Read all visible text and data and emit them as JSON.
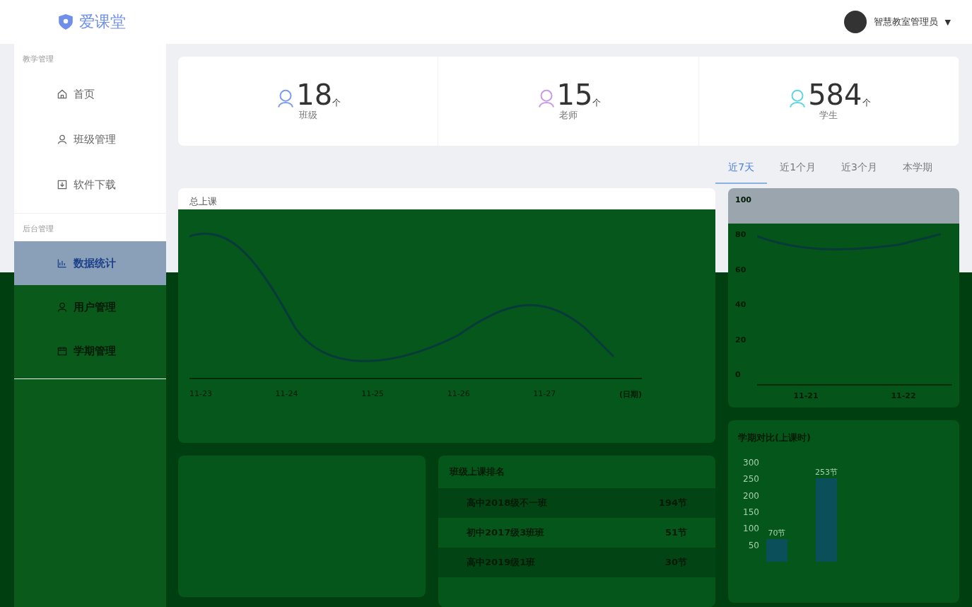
{
  "header": {
    "logo": "爱课堂",
    "user": "智慧教室管理员",
    "caret": "▼"
  },
  "sidebar": {
    "groups": [
      {
        "title": "教学管理",
        "items": [
          {
            "label": "首页",
            "selected": false
          },
          {
            "label": "班级管理",
            "selected": false
          },
          {
            "label": "软件下载",
            "selected": false
          }
        ]
      },
      {
        "title": "后台管理",
        "items": [
          {
            "label": "数据统计",
            "selected": true
          },
          {
            "label": "用户管理",
            "selected": false
          },
          {
            "label": "学期管理",
            "selected": false
          }
        ]
      }
    ]
  },
  "stats": [
    {
      "value": "18",
      "unit": "个",
      "label": "班级",
      "color": "#7b9cf0"
    },
    {
      "value": "15",
      "unit": "个",
      "label": "老师",
      "color": "#c89be8"
    },
    {
      "value": "584",
      "unit": "个",
      "label": "学生",
      "color": "#5fd6e0"
    }
  ],
  "tabs": [
    {
      "label": "近7天",
      "selected": true
    },
    {
      "label": "近1个月",
      "selected": false
    },
    {
      "label": "近3个月",
      "selected": false
    },
    {
      "label": "本学期",
      "selected": false
    }
  ],
  "trend_card": {
    "title": "总上课",
    "x_axis_name": "(日期)",
    "x_labels": [
      "11-23",
      "11-24",
      "11-25",
      "11-26",
      "11-27"
    ]
  },
  "small_trend": {
    "y_labels": [
      "100",
      "80",
      "60",
      "40",
      "20",
      "0"
    ],
    "x_labels": [
      "11-21",
      "11-22"
    ]
  },
  "ranking": {
    "title": "班级上课排名",
    "rows": [
      {
        "name": "高中2018级不一班",
        "count": "194节"
      },
      {
        "name": "初中2017级3班班",
        "count": "51节"
      },
      {
        "name": "高中2019级1班",
        "count": "30节"
      }
    ]
  },
  "term_chart": {
    "title": "学期对比(上课时)",
    "y_labels": [
      "300",
      "250",
      "200",
      "150",
      "100",
      "50"
    ],
    "bar_labels": [
      "70节",
      "253节"
    ]
  }
}
